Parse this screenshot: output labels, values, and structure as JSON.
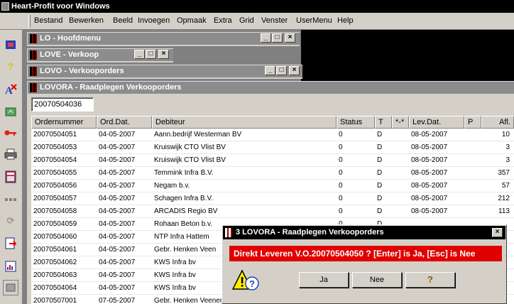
{
  "app": {
    "title": "Heart-Profit voor Windows"
  },
  "menu": [
    "Bestand",
    "Bewerken",
    "Beeld",
    "Invoegen",
    "Opmaak",
    "Extra",
    "Grid",
    "Venster",
    "UserMenu",
    "Help"
  ],
  "toolbar": {
    "icons": [
      "exit-icon",
      "help-icon",
      "spelling-icon",
      "import-icon",
      "key-icon",
      "print-icon",
      "calculator-icon",
      "dots-icon",
      "refresh-icon",
      "export-icon",
      "report-icon",
      "window-icon"
    ]
  },
  "windows": {
    "lo": "LO - Hoofdmenu",
    "love": "LOVE - Verkoop",
    "lovo": "LOVO - Verkooporders",
    "lovora": "LOVORA - Raadplegen Verkooporders"
  },
  "search": {
    "value": "20070504036"
  },
  "grid": {
    "columns": [
      "Ordernummer",
      "Ord.Dat.",
      "Debiteur",
      "Status",
      "T",
      "*-*",
      "Lev.Dat.",
      "P",
      "Afl."
    ],
    "rows": [
      [
        "20070504051",
        "04-05-2007",
        "Aann.bedrijf Westerman BV",
        "0",
        "D",
        "",
        "08-05-2007",
        "",
        "10"
      ],
      [
        "20070504053",
        "04-05-2007",
        "Kruiswijk CTO Vlist BV",
        "0",
        "D",
        "",
        "08-05-2007",
        "",
        "3"
      ],
      [
        "20070504054",
        "04-05-2007",
        "Kruiswijk CTO Vlist BV",
        "0",
        "D",
        "",
        "08-05-2007",
        "",
        "3"
      ],
      [
        "20070504055",
        "04-05-2007",
        "Temmink Infra B.V.",
        "0",
        "D",
        "",
        "08-05-2007",
        "",
        "357"
      ],
      [
        "20070504056",
        "04-05-2007",
        "Negam b.v.",
        "0",
        "D",
        "",
        "08-05-2007",
        "",
        "57"
      ],
      [
        "20070504057",
        "04-05-2007",
        "Schagen Infra B.V.",
        "0",
        "D",
        "",
        "08-05-2007",
        "",
        "212"
      ],
      [
        "20070504058",
        "04-05-2007",
        "ARCADIS Regio BV",
        "0",
        "D",
        "",
        "08-05-2007",
        "",
        "113"
      ],
      [
        "20070504059",
        "04-05-2007",
        "Rohaan Beton b.v.",
        "0",
        "D",
        "",
        "",
        "",
        ""
      ],
      [
        "20070504060",
        "04-05-2007",
        "NTP Infra Hattem",
        "",
        "",
        "",
        "",
        "",
        ""
      ],
      [
        "20070504061",
        "04-05-2007",
        "Gebr. Henken Veen",
        "",
        "",
        "",
        "",
        "",
        ""
      ],
      [
        "20070504062",
        "04-05-2007",
        "KWS Infra bv",
        "",
        "",
        "",
        "",
        "",
        ""
      ],
      [
        "20070504063",
        "04-05-2007",
        "KWS Infra bv",
        "",
        "",
        "",
        "",
        "",
        ""
      ],
      [
        "20070504064",
        "04-05-2007",
        "KWS Infra bv",
        "",
        "",
        "",
        "",
        "",
        ""
      ],
      [
        "20070507001",
        "07-05-2007",
        "Gebr. Henken Veenendaal BV",
        "",
        "",
        "",
        "",
        "",
        ""
      ]
    ]
  },
  "dialog": {
    "title": "3 LOVORA - Raadplegen Verkooporders",
    "message": "Direkt Leveren V.O.20070504050 ? [Enter] is Ja, [Esc] is Nee",
    "buttons": {
      "yes": "Ja",
      "no": "Nee",
      "help": "?"
    }
  }
}
